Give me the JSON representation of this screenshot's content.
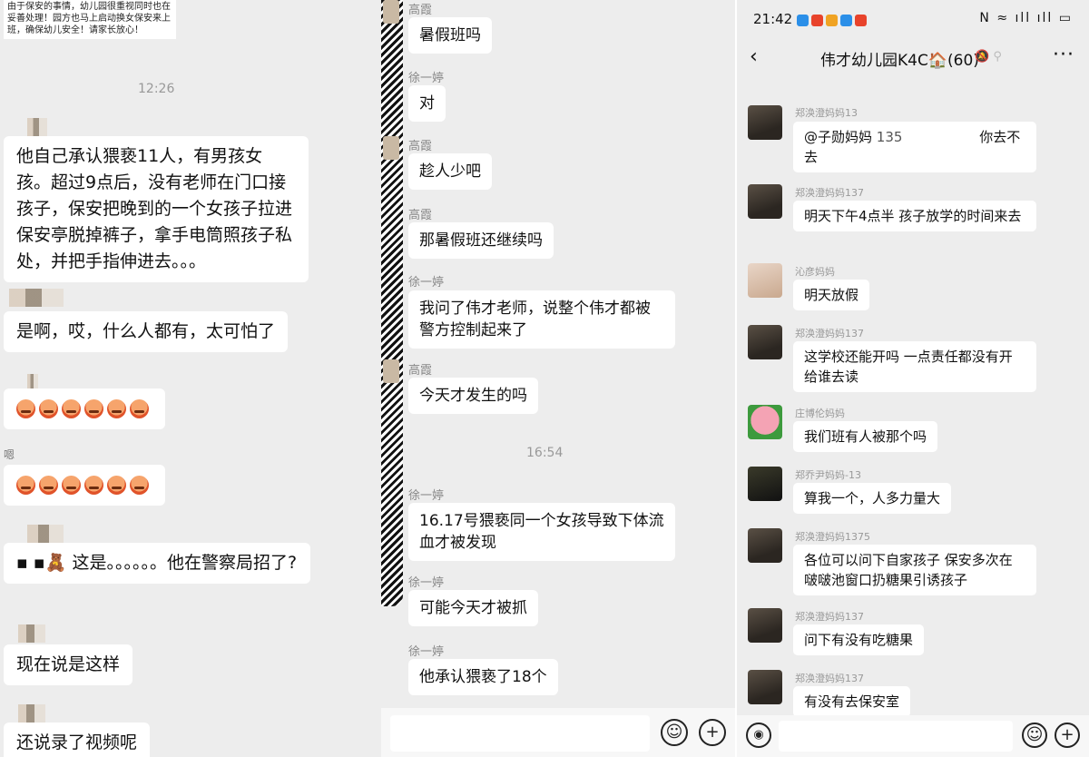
{
  "panel1": {
    "notice": "由于保安的事情，幼儿园很重视同时也在妥善处理！园方也马上启动换女保安来上班，确保幼儿安全！请家长放心！",
    "time": "12:26",
    "messages": [
      "他自己承认猥亵11人，有男孩女孩。超过9点后，没有老师在门口接孩子，保安把晚到的一个女孩子拉进保安亭脱掉裤子，拿手电筒照孩子私处，并把手指伸进去。。。",
      "是啊，哎，什么人都有，太可怕了",
      "这是。。。。。。他在警察局招了?",
      "现在说是这样",
      "还说录了视频呢"
    ],
    "side_label": "嗯"
  },
  "panel2": {
    "time": "16:54",
    "messages": [
      {
        "name": "高霞",
        "text": "暑假班吗"
      },
      {
        "name": "徐一婷",
        "text": "对"
      },
      {
        "name": "高霞",
        "text": "趁人少吧"
      },
      {
        "name": "高霞",
        "text": "那暑假班还继续吗"
      },
      {
        "name": "徐一婷",
        "text": "我问了伟才老师，说整个伟才都被警方控制起来了"
      },
      {
        "name": "高霞",
        "text": "今天才发生的吗"
      },
      {
        "name": "徐一婷",
        "text": "16.17号猥亵同一个女孩导致下体流血才被发现"
      },
      {
        "name": "徐一婷",
        "text": "可能今天才被抓"
      },
      {
        "name": "徐一婷",
        "text": "他承认猥亵了18个"
      }
    ],
    "emoji_button": "☺",
    "add_button": "+"
  },
  "panel3": {
    "clock": "21:42",
    "status_icons": "N ≈ ıll ıll ▭",
    "title": "伟才幼儿园K4C🏠(60)",
    "back_icon": "‹",
    "more_icon": "···",
    "messages": [
      {
        "name": "郑涣澄妈妈13",
        "mention": "@子勋妈妈",
        "number": "135",
        "text_after": "你去不去"
      },
      {
        "name": "郑涣澄妈妈137",
        "text": "明天下午4点半 孩子放学的时间来去"
      },
      {
        "name": "沁彦妈妈",
        "text": "明天放假"
      },
      {
        "name": "郑涣澄妈妈137",
        "text": "这学校还能开吗 一点责任都没有开给谁去读"
      },
      {
        "name": "庄博伦妈妈",
        "text": "我们班有人被那个吗"
      },
      {
        "name": "郑乔尹妈妈-13",
        "text": "算我一个，人多力量大"
      },
      {
        "name": "郑涣澄妈妈1375",
        "text": "各位可以问下自家孩子 保安多次在啵啵池窗口扔糖果引诱孩子"
      },
      {
        "name": "郑涣澄妈妈137",
        "text": "问下有没有吃糖果"
      },
      {
        "name": "郑涣澄妈妈137",
        "text": "有没有去保安室"
      }
    ]
  }
}
